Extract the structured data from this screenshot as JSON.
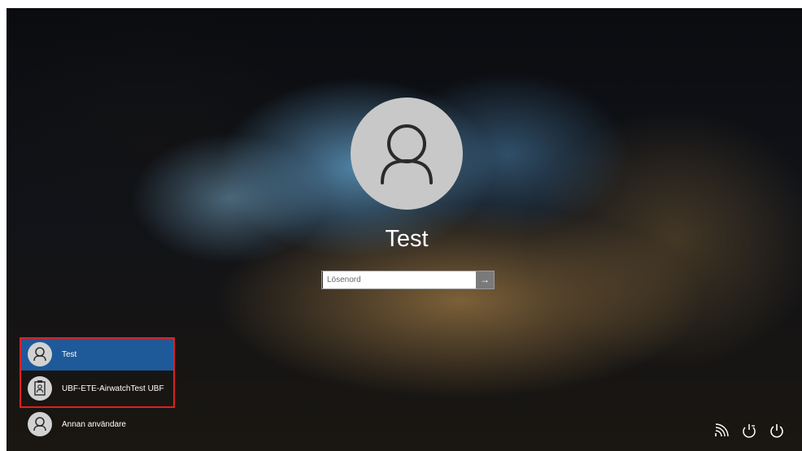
{
  "login": {
    "user_name": "Test",
    "password_placeholder": "Lösenord",
    "submit_icon": "arrow-right-icon"
  },
  "user_list": [
    {
      "label": "Test",
      "icon": "person-icon",
      "selected": true
    },
    {
      "label": "UBF-ETE-AirwatchTest UBF",
      "icon": "badge-person-icon",
      "selected": false
    },
    {
      "label": "Annan användare",
      "icon": "person-icon",
      "selected": false
    }
  ],
  "system_tray": [
    {
      "icon": "network-icon"
    },
    {
      "icon": "ease-of-access-icon"
    },
    {
      "icon": "power-icon"
    }
  ],
  "colors": {
    "selected_user_bg": "#1e5a9a",
    "highlight_border": "#e02020",
    "avatar_bg": "#c8c8c8"
  }
}
